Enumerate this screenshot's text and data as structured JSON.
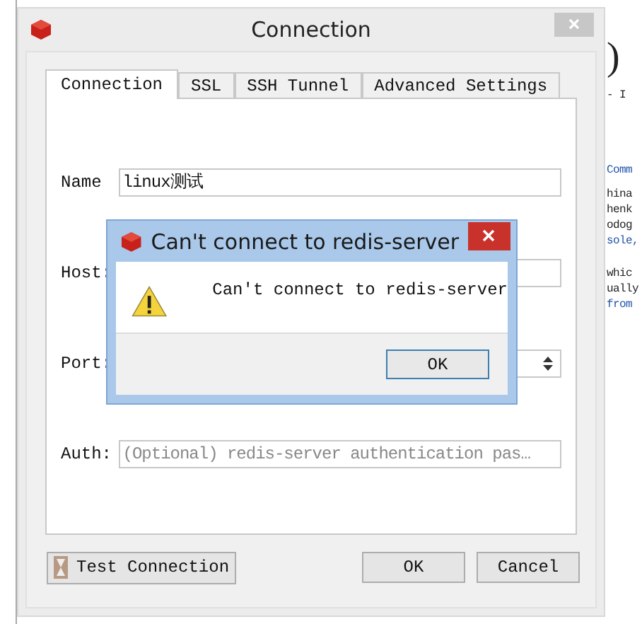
{
  "background_page": {
    "fragments": [
      {
        "text": ")",
        "kind": "heading"
      },
      {
        "text": "- I",
        "kind": "plain"
      },
      {
        "text": "Comm",
        "kind": "link"
      },
      {
        "text": "hina",
        "kind": "plain"
      },
      {
        "text": "henk",
        "kind": "plain"
      },
      {
        "text": "odog",
        "kind": "plain"
      },
      {
        "text": "sole,",
        "kind": "link"
      },
      {
        "text": "whic",
        "kind": "plain"
      },
      {
        "text": "ually",
        "kind": "plain"
      },
      {
        "text": "from",
        "kind": "link"
      }
    ]
  },
  "window": {
    "title": "Connection"
  },
  "tabs": [
    {
      "label": "Connection",
      "selected": true
    },
    {
      "label": "SSL",
      "selected": false
    },
    {
      "label": "SSH Tunnel",
      "selected": false
    },
    {
      "label": "Advanced Settings",
      "selected": false
    }
  ],
  "fields": [
    {
      "label": "Name",
      "value": "linux测试",
      "kind": "text"
    },
    {
      "label": "Host:",
      "kind": "text"
    },
    {
      "label": "Port:",
      "kind": "spin"
    },
    {
      "label": "Auth:",
      "placeholder": "(Optional) redis-server authentication pas…",
      "kind": "text"
    }
  ],
  "buttons": {
    "test": "Test Connection",
    "ok": "OK",
    "cancel": "Cancel"
  },
  "error_dialog": {
    "title": "Can't connect to redis-server",
    "message": "Can't connect to redis-server",
    "button": "OK"
  }
}
